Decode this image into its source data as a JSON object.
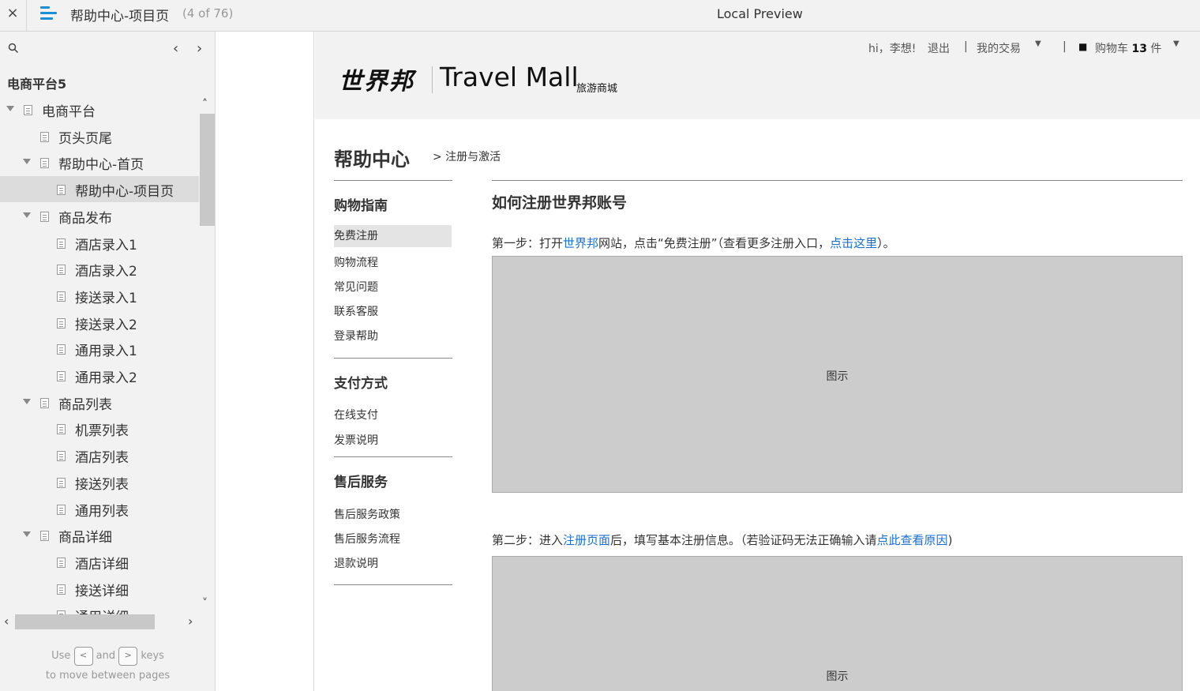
{
  "topbar": {
    "close": "×",
    "page_title": "帮助中心-项目页",
    "page_count": "(4 of 76)",
    "center_title": "Local Preview"
  },
  "sidebar": {
    "project": "电商平台5",
    "prev": "‹",
    "next": "›",
    "tree": [
      {
        "label": "电商平台",
        "level": 0,
        "expanded": true
      },
      {
        "label": "页头页尾",
        "level": 1
      },
      {
        "label": "帮助中心-首页",
        "level": 1,
        "expanded": true
      },
      {
        "label": "帮助中心-项目页",
        "level": 2,
        "selected": true
      },
      {
        "label": "商品发布",
        "level": 1,
        "expanded": true
      },
      {
        "label": "酒店录入1",
        "level": 2
      },
      {
        "label": "酒店录入2",
        "level": 2
      },
      {
        "label": "接送录入1",
        "level": 2
      },
      {
        "label": "接送录入2",
        "level": 2
      },
      {
        "label": "通用录入1",
        "level": 2
      },
      {
        "label": "通用录入2",
        "level": 2
      },
      {
        "label": "商品列表",
        "level": 1,
        "expanded": true
      },
      {
        "label": "机票列表",
        "level": 2
      },
      {
        "label": "酒店列表",
        "level": 2
      },
      {
        "label": "接送列表",
        "level": 2
      },
      {
        "label": "通用列表",
        "level": 2
      },
      {
        "label": "商品详细",
        "level": 1,
        "expanded": true
      },
      {
        "label": "酒店详细",
        "level": 2
      },
      {
        "label": "接送详细",
        "level": 2
      },
      {
        "label": "通用详细",
        "level": 2
      }
    ],
    "hint": {
      "use": "Use",
      "key_left": "<",
      "and": "and",
      "key_right": ">",
      "keys": "keys",
      "line2": "to move between pages"
    }
  },
  "site": {
    "user": {
      "greeting": "hi，李想!",
      "logout": "退出",
      "my_trade": "我的交易",
      "cart_label": "购物车",
      "cart_count": "13",
      "cart_unit": "件"
    },
    "logo": {
      "cn": "世界邦",
      "en": "Travel Mall",
      "sub": "旅游商城"
    },
    "help_title": "帮助中心",
    "breadcrumb": "> 注册与激活",
    "sections": [
      {
        "title": "购物指南",
        "items": [
          "免费注册",
          "购物流程",
          "常见问题",
          "联系客服",
          "登录帮助"
        ]
      },
      {
        "title": "支付方式",
        "items": [
          "在线支付",
          "发票说明"
        ]
      },
      {
        "title": "售后服务",
        "items": [
          "售后服务政策",
          "售后服务流程",
          "退款说明"
        ]
      }
    ],
    "active_item": "免费注册",
    "article": {
      "title": "如何注册世界邦账号",
      "step1": {
        "pre": "第一步：打开",
        "link1": "世界邦",
        "mid": "网站，点击“免费注册”（查看更多注册入口，",
        "link2": "点击这里",
        "post": "）。"
      },
      "step2": {
        "pre": "第二步：进入",
        "link1": "注册页面",
        "mid": "后，填写基本注册信息。（若验证码无法正确输入请",
        "link2": "点此查看原因",
        "post": ")"
      },
      "figure_label": "图示"
    }
  }
}
